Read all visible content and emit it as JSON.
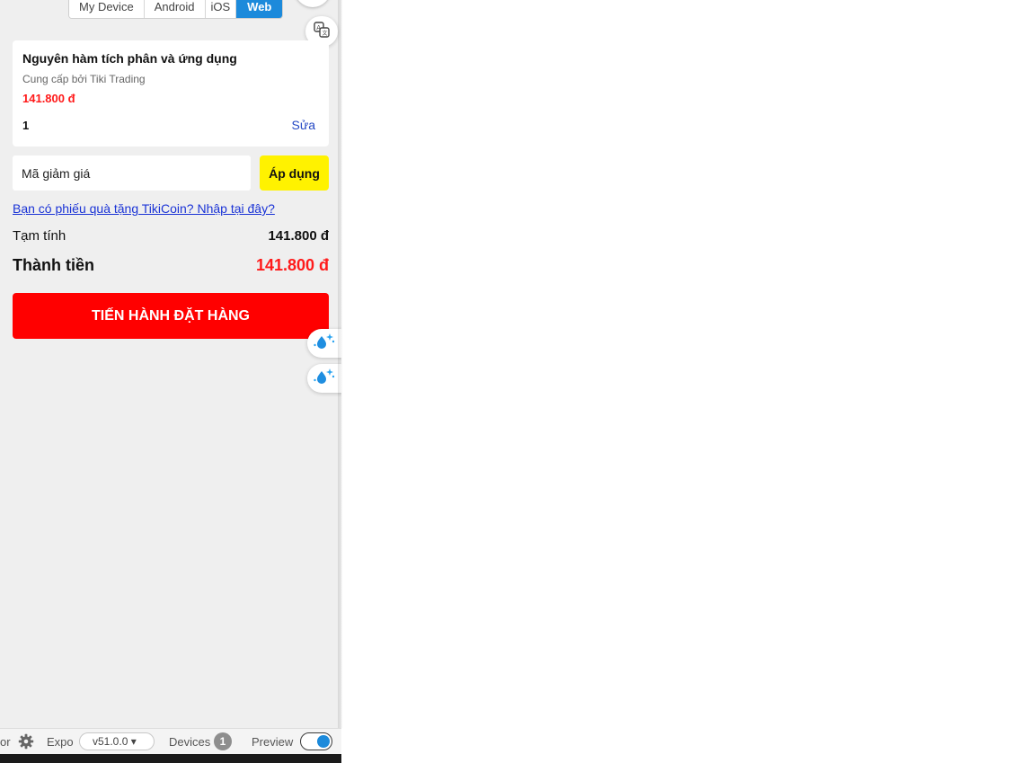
{
  "platform_tabs": [
    "My Device",
    "Android",
    "iOS",
    "Web"
  ],
  "active_platform": "Web",
  "product": {
    "title": "Nguyên hàm tích phân và ứng dụng",
    "seller": "Cung cấp bởi Tiki Trading",
    "price": "141.800 đ",
    "quantity": "1",
    "edit_label": "Sửa"
  },
  "coupon": {
    "placeholder": "Mã giảm giá",
    "apply_label": "Áp dụng",
    "tikicoin_link": "Bạn có phiếu quà tặng TikiCoin? Nhập tại đây?"
  },
  "summary": {
    "subtotal_label": "Tạm tính",
    "subtotal_value": "141.800 đ",
    "total_label": "Thành tiền",
    "total_value": "141.800 đ"
  },
  "checkout_label": "TIẾN HÀNH ĐẶT HÀNG",
  "bottom_bar": {
    "editor_fragment": "or",
    "expo_label": "Expo",
    "version": "v51.0.0 ▾",
    "devices_label": "Devices",
    "devices_count": "1",
    "preview_label": "Preview"
  },
  "colors": {
    "price_red": "#ff1a1a",
    "checkout_red": "#ff0000",
    "apply_yellow": "#fff200",
    "link_blue": "#1a33d6",
    "active_tab": "#1c8adb"
  },
  "icons": {
    "translate": "translate-icon",
    "drop_sparkle": "water-drop-sparkle-icon",
    "settings": "gear-icon"
  }
}
